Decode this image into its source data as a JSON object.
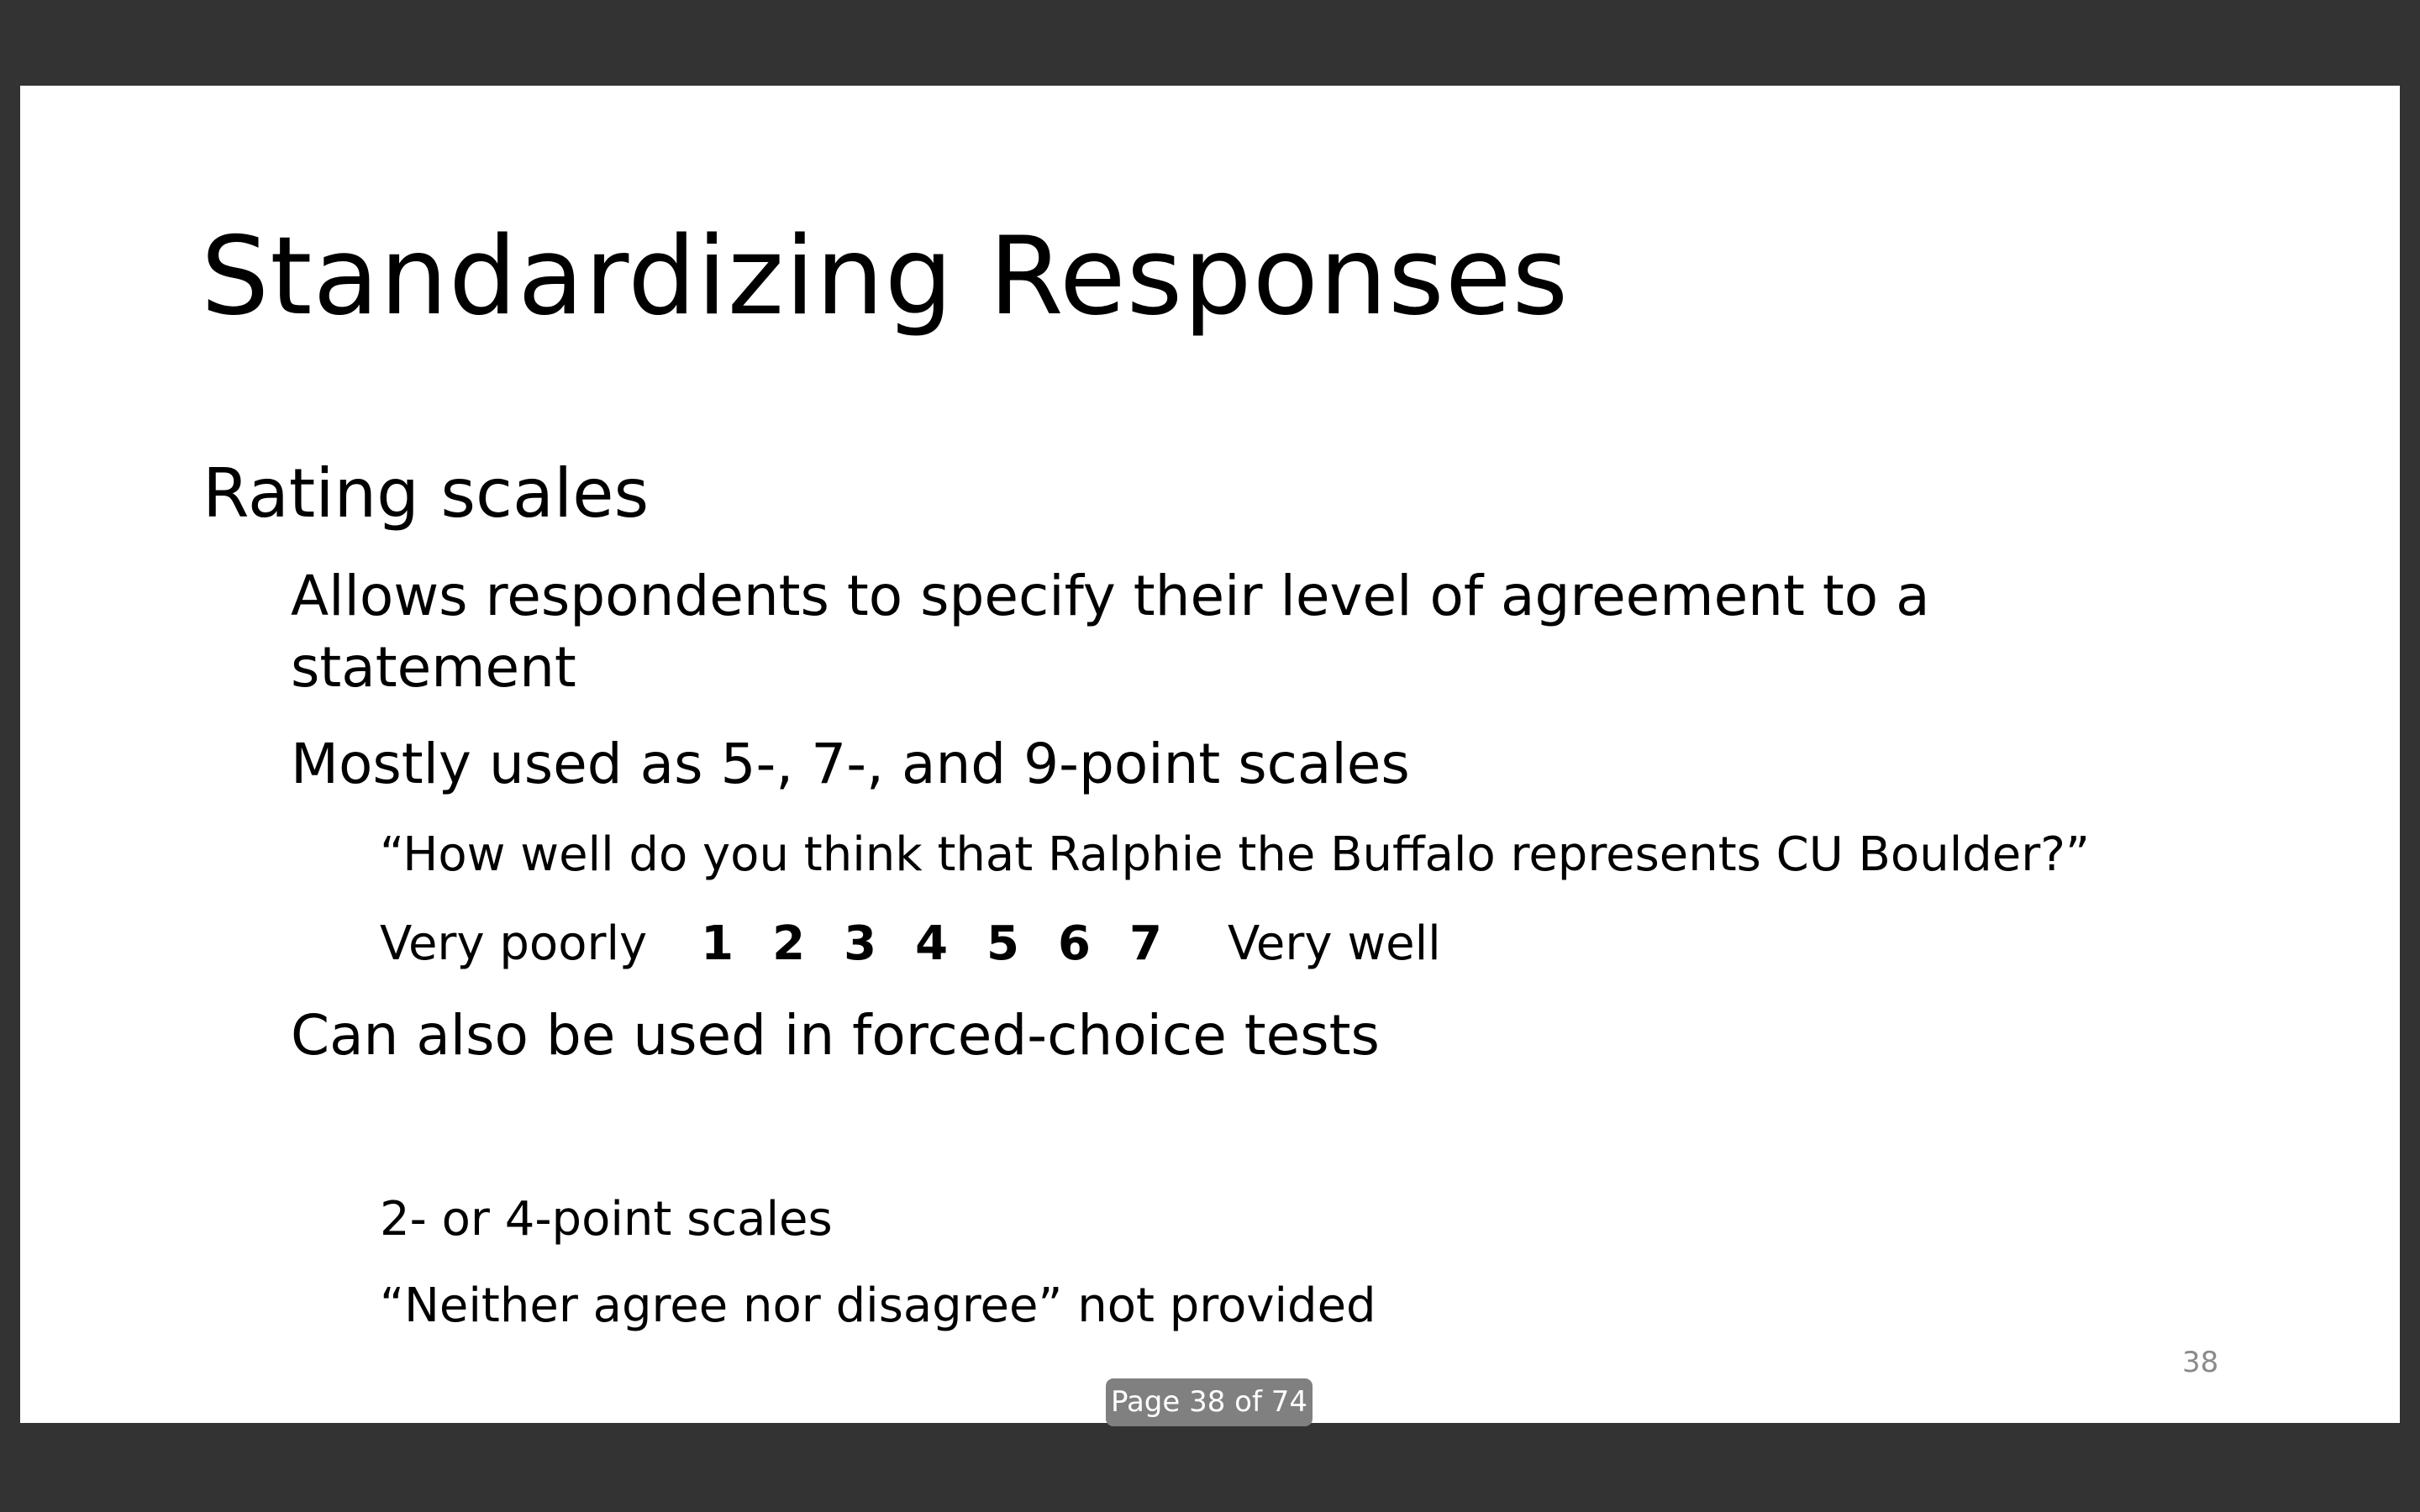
{
  "slide": {
    "title": "Standardizing Responses",
    "heading": "Rating scales",
    "bullets": {
      "agreement_line1": "Allows respondents to specify their level of agreement to a",
      "agreement_line2": "statement",
      "usage": "Mostly used as 5-, 7-, and 9-point scales",
      "example_question": "“How well do you think that Ralphie the Buffalo represents CU Boulder?”",
      "scale": {
        "low_label": "Very poorly",
        "points": [
          "1",
          "2",
          "3",
          "4",
          "5",
          "6",
          "7"
        ],
        "high_label": "Very well"
      },
      "forced_choice": "Can also be used in forced-choice tests",
      "forced_points": "2- or 4-point scales",
      "neutral_note": "“Neither agree nor disagree” not provided"
    },
    "slide_number": "38"
  },
  "viewer": {
    "page_indicator": "Page 38 of 74",
    "colors": {
      "background": "#333333",
      "slide": "#ffffff",
      "indicator": "#808080"
    }
  }
}
